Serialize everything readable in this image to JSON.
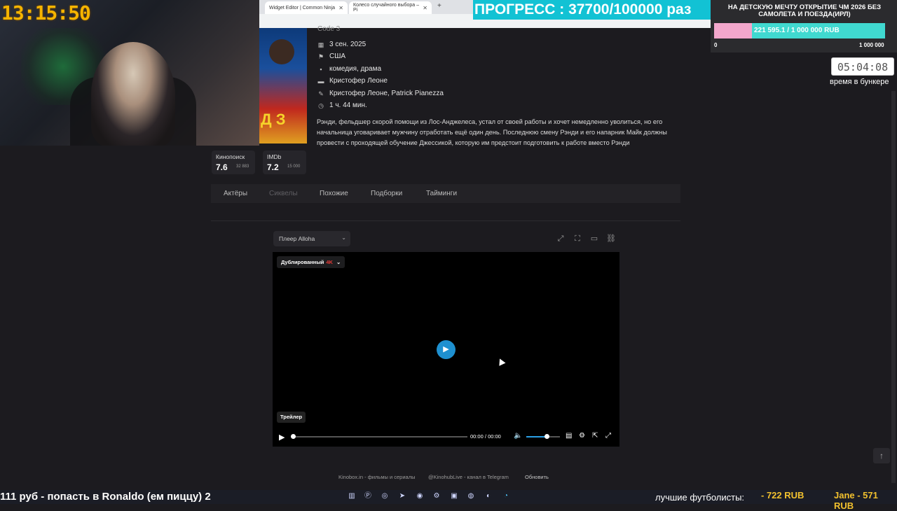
{
  "stream_clock": "13:15:50",
  "browser": {
    "tabs": [
      {
        "label": "Widget Editor | Common Ninja",
        "close": "✕"
      },
      {
        "label": "Колесо случайного выбора – Pi",
        "close": "✕"
      }
    ],
    "new_tab": "+"
  },
  "movie": {
    "title_partial": "Code 3",
    "poster_text": "Д З",
    "details": [
      {
        "icon": "calendar-icon",
        "glyph": "▦",
        "text": "3 сен. 2025"
      },
      {
        "icon": "flag-icon",
        "glyph": "⚑",
        "text": "США"
      },
      {
        "icon": "genre-icon",
        "glyph": "▪",
        "text": "комедия, драма"
      },
      {
        "icon": "director-icon",
        "glyph": "▬",
        "text": "Кристофер Леоне"
      },
      {
        "icon": "pencil-icon",
        "glyph": "✎",
        "text": "Кристофер Леоне, Patrick Pianezza"
      },
      {
        "icon": "clock-icon",
        "glyph": "◷",
        "text": "1 ч. 44 мин."
      }
    ],
    "description": "Рэнди, фельдшер скорой помощи из Лос-Анджелеса, устал от своей работы и хочет немедленно уволиться, но его начальница уговаривает мужчину отработать ещё один день. Последнюю смену Рэнди и его напарник Майк должны провести с проходящей обучение Джессикой, которую им предстоит подготовить к работе вместо Рэнди",
    "ratings": [
      {
        "name": "Кинопоиск",
        "score": "7.6",
        "votes": "32 883"
      },
      {
        "name": "IMDb",
        "score": "7.2",
        "votes": "15 000"
      }
    ]
  },
  "nav_tabs": [
    {
      "label": "Актёры"
    },
    {
      "label": "Сиквелы"
    },
    {
      "label": "Похожие"
    },
    {
      "label": "Подборки"
    },
    {
      "label": "Тайминги"
    }
  ],
  "player": {
    "select_label": "Плеер Alloha",
    "select_chevron": "⌄",
    "dub_label": "Дублированный",
    "dub_quality": "4K",
    "dub_chevron": "⌄",
    "trailer_label": "Трейлер",
    "time_current": "00:00",
    "time_sep": "/",
    "time_total": "00:00",
    "volume_fraction": 0.6,
    "progress_fraction": 0.0
  },
  "footer": {
    "site": "Kinobox.in - фильмы и сериалы",
    "telegram": "@KinohubLive - канал в Telegram",
    "refresh": "Обновить"
  },
  "overlay": {
    "progress_banner": "ПРОГРЕСС : 37700/100000 раз",
    "goal_title": "НА ДЕТСКУЮ МЕЧТУ ОТКРЫТИЕ ЧМ 2026 БЕЗ САМОЛЕТА И ПОЕЗДА(ИРЛ)",
    "goal_amount": "221 595.1 / 1 000 000 RUB",
    "goal_min": "0",
    "goal_max": "1 000 000",
    "goal_fraction": 0.2216,
    "bunker_timer": "05:04:08",
    "bunker_label": "время в бункере"
  },
  "taskbar": {
    "ticker": "111 руб - попасть в Ronaldo (ем пиццу) 2",
    "donate_text": "лучшие футболисты:",
    "donate_amount": "- 722 RUB",
    "donate_user": "Jane - 571 RUB"
  },
  "colors": {
    "accent": "#1e90d0",
    "progress_banner": "#12c2d4",
    "goal_bar": "#40d9d0",
    "goal_fill": "#f3a7cc",
    "clock": "#f5b400"
  }
}
